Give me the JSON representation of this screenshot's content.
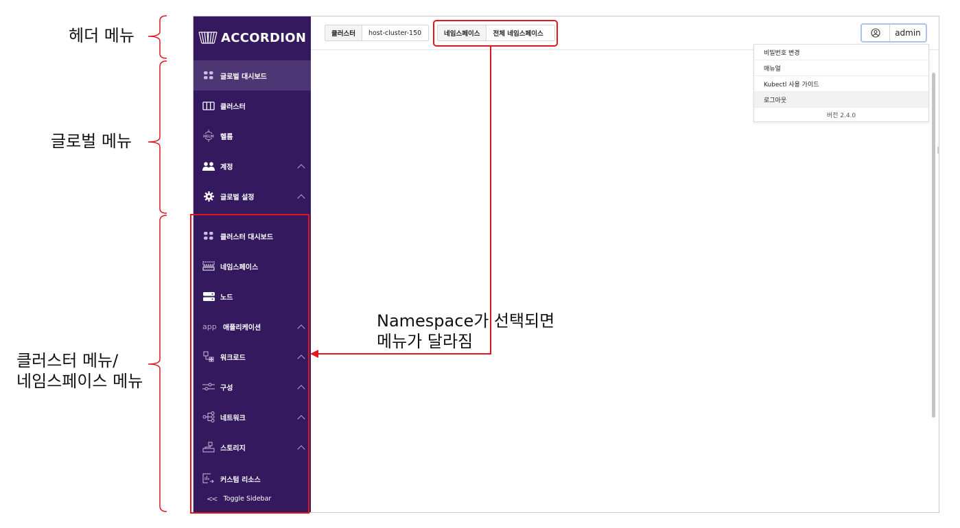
{
  "annotations": {
    "header_menu": "헤더 메뉴",
    "global_menu": "글로벌 메뉴",
    "cluster_menu_line1": "클러스터 메뉴/",
    "cluster_menu_line2": "네임스페이스 메뉴",
    "namespace_note_line1": "Namespace가 선택되면",
    "namespace_note_line2": "메뉴가 달라짐",
    "highlight_color": "#e0161c"
  },
  "app": {
    "logo": "ACCORDION",
    "sidebar_color": "#34195e",
    "global_menu": [
      {
        "label": "글로벌 대시보드",
        "icon": "dashboard-icon",
        "active": true
      },
      {
        "label": "클러스터",
        "icon": "cluster-icon"
      },
      {
        "label": "헬름",
        "icon": "helm-icon"
      },
      {
        "label": "계정",
        "icon": "users-icon",
        "expandable": true
      },
      {
        "label": "글로벌 설정",
        "icon": "gear-icon",
        "expandable": true
      }
    ],
    "cluster_menu": [
      {
        "label": "클러스터 대시보드",
        "icon": "dashboard-icon"
      },
      {
        "label": "네임스페이스",
        "icon": "namespace-icon"
      },
      {
        "label": "노드",
        "icon": "server-icon"
      },
      {
        "label": "애플리케이션",
        "icon_text": "app",
        "expandable": true
      },
      {
        "label": "워크로드",
        "icon": "workload-icon",
        "expandable": true
      },
      {
        "label": "구성",
        "icon": "sliders-icon",
        "expandable": true
      },
      {
        "label": "네트워크",
        "icon": "network-icon",
        "expandable": true
      },
      {
        "label": "스토리지",
        "icon": "storage-icon",
        "expandable": true
      },
      {
        "label": "커스텀 리소스",
        "icon": "custom-resource-icon"
      }
    ],
    "toggle_sidebar": "Toggle Sidebar",
    "header": {
      "cluster_label": "클러스터",
      "cluster_value": "host-cluster-150",
      "namespace_label": "네임스페이스",
      "namespace_value": "전체 네임스페이스",
      "user": "admin"
    },
    "user_dropdown": {
      "items": [
        "비밀번호 변경",
        "매뉴얼",
        "Kubectl 사용 가이드",
        "로그아웃"
      ],
      "version": "버전 2.4.0"
    }
  }
}
